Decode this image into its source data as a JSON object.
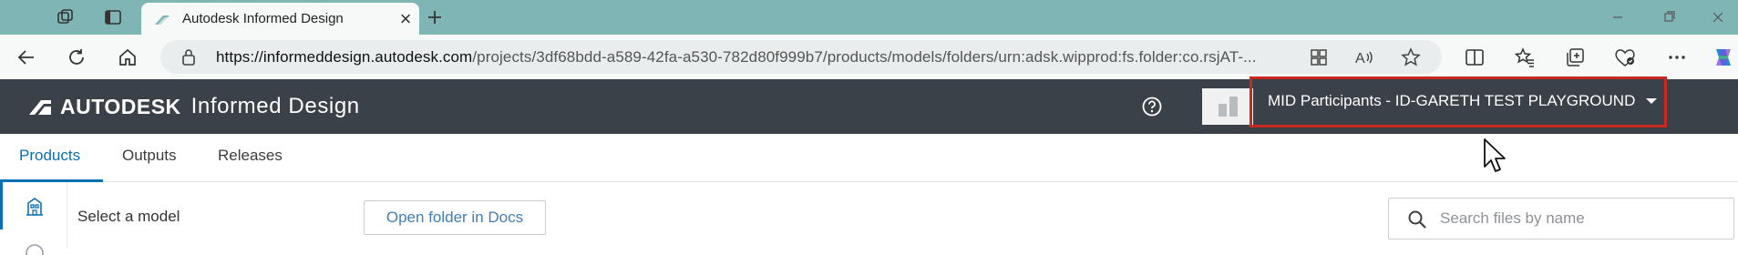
{
  "browser": {
    "tab": {
      "title": "Autodesk Informed Design",
      "close_glyph": "×"
    },
    "new_tab_glyph": "+",
    "address_bar": {
      "url_domain": "https://informeddesign.autodesk.com",
      "url_rest": "/projects/3df68bdd-a589-42fa-a530-782d80f999b7/products/models/folders/urn:adsk.wipprod:fs.folder:co.rsjAT-..."
    },
    "icons": [
      "workspaces-icon",
      "tab-actions-icon",
      "back-icon",
      "refresh-icon",
      "home-icon",
      "lock-icon",
      "app-available-icon",
      "read-aloud-icon",
      "favorite-star-icon",
      "split-screen-icon",
      "favorites-icon",
      "collections-icon",
      "browser-essentials-icon",
      "more-icon",
      "copilot-icon",
      "minimize-icon",
      "maximize-icon",
      "close-window-icon"
    ]
  },
  "app": {
    "brand": {
      "wordmark": "AUTODESK",
      "product": "Informed Design"
    },
    "hub_selector": {
      "label": "MID Participants - ID-GARETH TEST PLAYGROUND"
    },
    "tabs": [
      {
        "label": "Products",
        "active": true
      },
      {
        "label": "Outputs",
        "active": false
      },
      {
        "label": "Releases",
        "active": false
      }
    ],
    "content": {
      "select_label": "Select a model",
      "open_folder_label": "Open folder in Docs",
      "search_placeholder": "Search files by name"
    },
    "colors": {
      "header_bg": "#3b4149",
      "accent": "#0b6fb3",
      "highlight_box": "#c8281e"
    }
  }
}
